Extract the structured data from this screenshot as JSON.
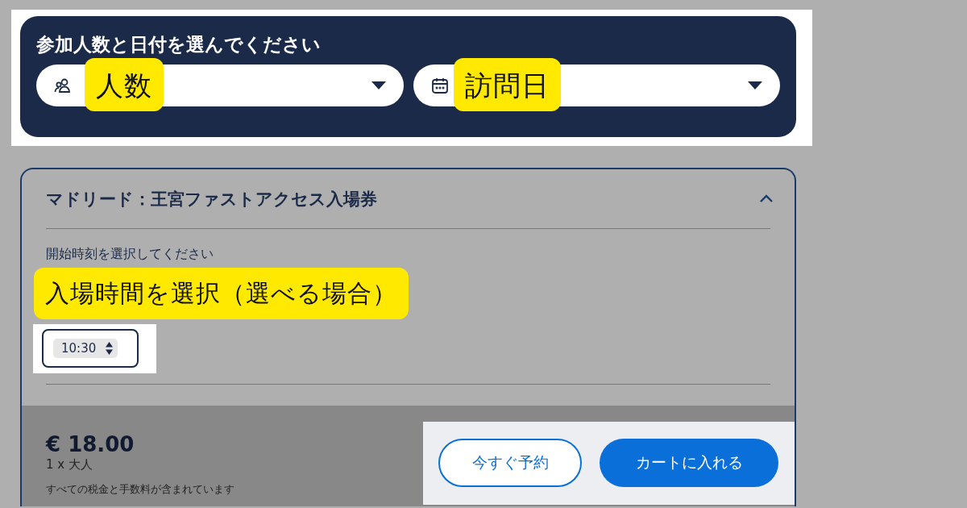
{
  "header": {
    "title": "参加人数と日付を選んでください",
    "fields": [
      {
        "kind": "people",
        "annotation": "人数"
      },
      {
        "kind": "date",
        "annotation": "訪問日"
      }
    ]
  },
  "ticket": {
    "title": "マドリード：王宮ファストアクセス入場券",
    "expanded": true,
    "time_prompt": "開始時刻を選択してください",
    "time_annotation": "入場時間を選択（選べる場合）",
    "time_value": "10:30",
    "price": "€ 18.00",
    "quantity": "1 x 大人",
    "tax_note": "すべての税金と手数料が含まれています",
    "buttons": [
      {
        "kind": "outline",
        "label": "今すぐ予約"
      },
      {
        "kind": "primary",
        "label": "カートに入れる"
      }
    ]
  }
}
